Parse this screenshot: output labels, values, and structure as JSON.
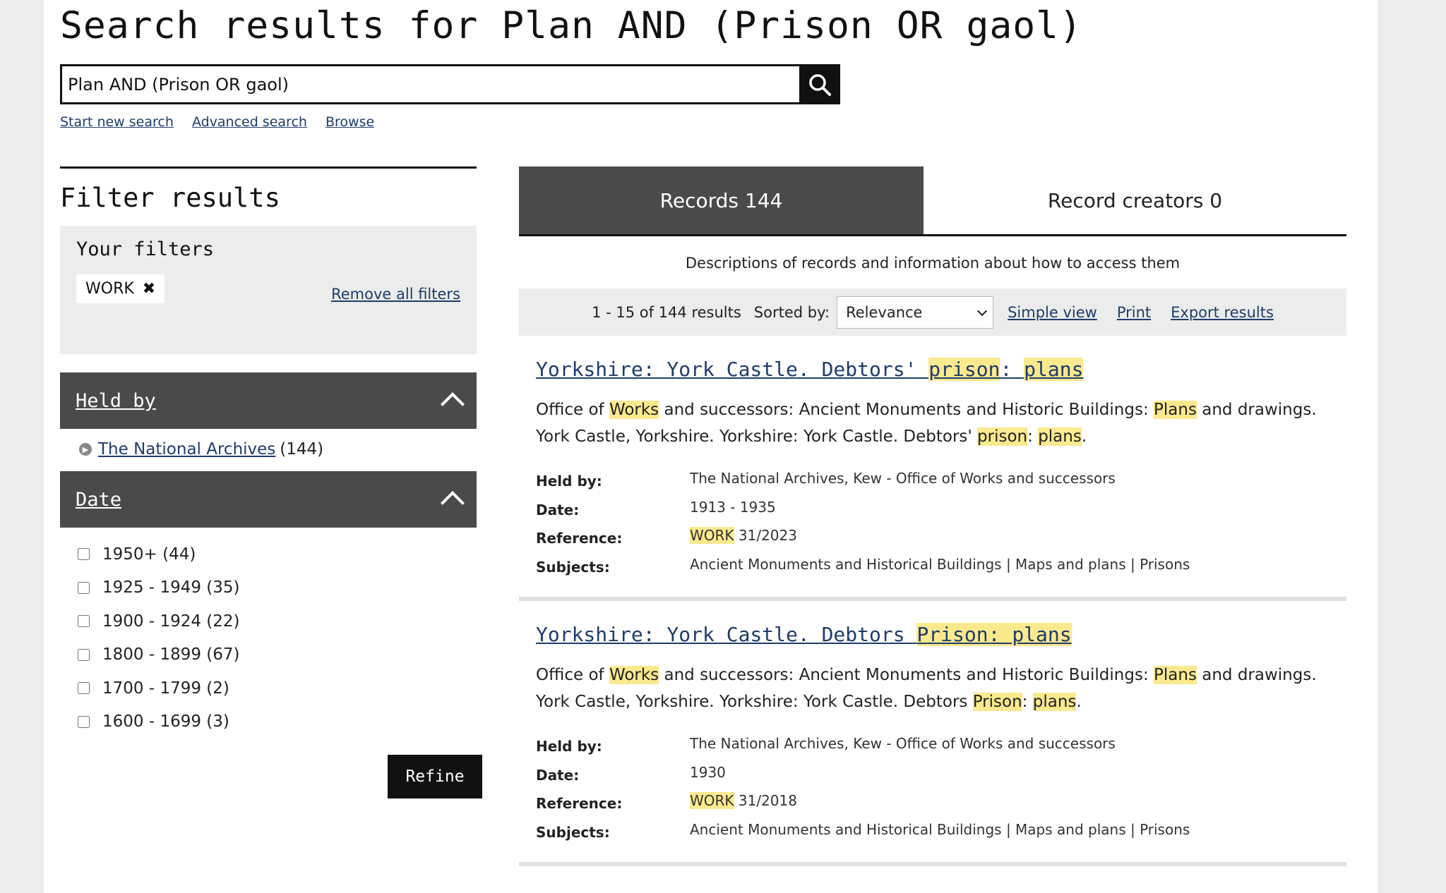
{
  "header": {
    "title": "Search results for Plan AND (Prison OR gaol)",
    "search_value": "Plan AND (Prison OR gaol)",
    "links": [
      "Start new search",
      "Advanced search",
      "Browse"
    ]
  },
  "sidebar": {
    "heading": "Filter results",
    "your_filters": {
      "heading": "Your filters",
      "chips": [
        "WORK"
      ],
      "remove_all": "Remove all filters"
    },
    "held_by": {
      "label": "Held by",
      "items": [
        {
          "name": "The National Archives",
          "count": "(144)"
        }
      ]
    },
    "date": {
      "label": "Date",
      "options": [
        "1950+ (44)",
        "1925 - 1949 (35)",
        "1900 - 1924 (22)",
        "1800 - 1899 (67)",
        "1700 - 1799 (2)",
        "1600 - 1699 (3)"
      ]
    },
    "refine_label": "Refine"
  },
  "main": {
    "tabs": [
      {
        "label": "Records 144",
        "active": true
      },
      {
        "label": "Record creators 0",
        "active": false
      }
    ],
    "tab_description": "Descriptions of records and information about how to access them",
    "toolbar": {
      "count": "1 - 15 of 144 results",
      "sort_label": "Sorted by:",
      "sort_value": "Relevance",
      "links": [
        "Simple view",
        "Print",
        "Export results"
      ]
    },
    "meta_labels": {
      "held_by": "Held by:",
      "date": "Date:",
      "reference": "Reference:",
      "subjects": "Subjects:"
    },
    "results": [
      {
        "title_parts": [
          {
            "t": "Yorkshire: York Castle. Debtors' ",
            "h": false
          },
          {
            "t": "prison",
            "h": true
          },
          {
            "t": ": ",
            "h": false
          },
          {
            "t": "plans",
            "h": true
          }
        ],
        "desc_parts": [
          {
            "t": "Office of ",
            "h": false
          },
          {
            "t": "Works",
            "h": true
          },
          {
            "t": " and successors: Ancient Monuments and Historic Buildings: ",
            "h": false
          },
          {
            "t": "Plans",
            "h": true
          },
          {
            "t": " and drawings. York Castle, Yorkshire. Yorkshire: York Castle. Debtors' ",
            "h": false
          },
          {
            "t": "prison",
            "h": true
          },
          {
            "t": ": ",
            "h": false
          },
          {
            "t": "plans",
            "h": true
          },
          {
            "t": ".",
            "h": false
          }
        ],
        "held_by": "The National Archives, Kew - Office of Works and successors",
        "date": "1913 - 1935",
        "reference_prefix": "WORK",
        "reference_rest": " 31/2023",
        "subjects": "Ancient Monuments and Historical Buildings | Maps and plans | Prisons"
      },
      {
        "title_parts": [
          {
            "t": "Yorkshire: York Castle. Debtors ",
            "h": false
          },
          {
            "t": "Prison",
            "h": true
          },
          {
            "t": ": ",
            "h": true
          },
          {
            "t": "plans",
            "h": true
          }
        ],
        "desc_parts": [
          {
            "t": "Office of ",
            "h": false
          },
          {
            "t": "Works",
            "h": true
          },
          {
            "t": " and successors: Ancient Monuments and Historic Buildings: ",
            "h": false
          },
          {
            "t": "Plans",
            "h": true
          },
          {
            "t": " and drawings. York Castle, Yorkshire. Yorkshire: York Castle. Debtors ",
            "h": false
          },
          {
            "t": "Prison",
            "h": true
          },
          {
            "t": ": ",
            "h": false
          },
          {
            "t": "plans",
            "h": true
          },
          {
            "t": ".",
            "h": false
          }
        ],
        "held_by": "The National Archives, Kew - Office of Works and successors",
        "date": "1930",
        "reference_prefix": "WORK",
        "reference_rest": " 31/2018",
        "subjects": "Ancient Monuments and Historical Buildings | Maps and plans | Prisons"
      }
    ]
  },
  "colors": {
    "accent_dark": "#4a4a4a",
    "link": "#1e3c6b",
    "highlight": "#fbe98e",
    "panel": "#ececec"
  }
}
